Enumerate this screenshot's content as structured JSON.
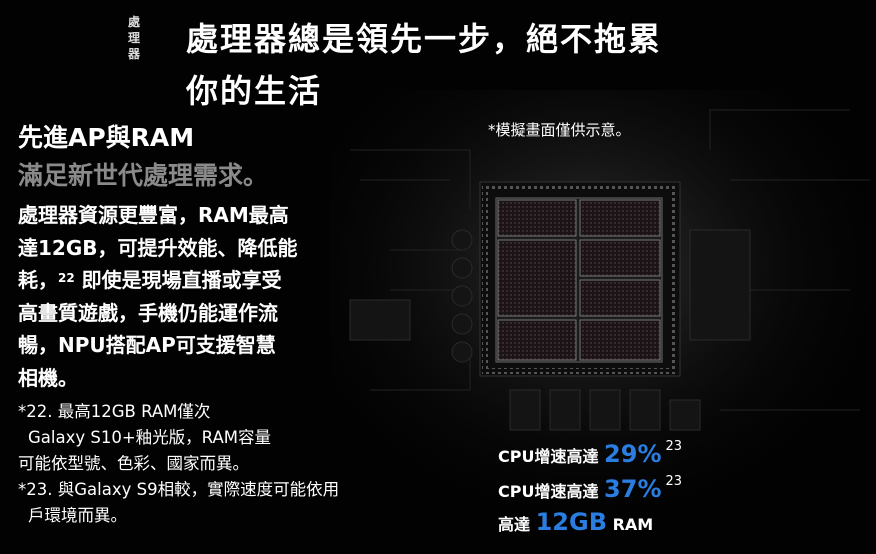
{
  "colors": {
    "background": "#020202",
    "accent_blue": "#2a7de1",
    "muted_gray": "#8a8a8a"
  },
  "side_tag": "處理器",
  "headline": {
    "line1": "處理器總是領先一步，絕不拖累",
    "line2": "你的生活"
  },
  "subhead": {
    "line1": "先進AP與RAM",
    "line2": "滿足新世代處理需求。"
  },
  "body": {
    "lines": [
      "處理器資源更豐富，RAM最高",
      "達12GB，可提升效能、降低能",
      "耗，",
      "即使是現場直播或享受",
      "高畫質遊戲，手機仍能運作流",
      "暢，NPU搭配AP可支援智慧",
      "相機。"
    ],
    "sup": "22"
  },
  "notes": [
    "*22. 最高12GB RAM僅次",
    "Galaxy S10+釉光版，RAM容量",
    "可能依型號、色彩、國家而異。",
    "*23. 與Galaxy S9相較，實際速度可能依用",
    "戶環境而異。"
  ],
  "disclaimer": "*模擬畫面僅供示意。",
  "stats": [
    {
      "label": "CPU增速高達",
      "value": "29%",
      "sup": "23"
    },
    {
      "label": "CPU增速高達",
      "value": "37%",
      "sup": "23"
    },
    {
      "label": "高達",
      "value": "12GB",
      "suffix": "RAM"
    }
  ]
}
